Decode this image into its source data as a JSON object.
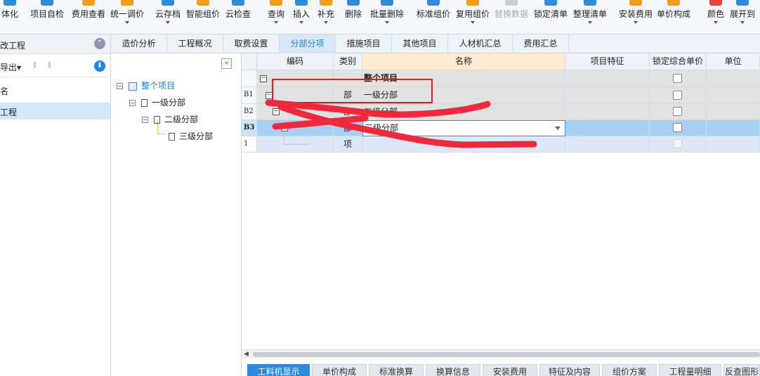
{
  "toolbar": {
    "items": [
      {
        "label": "体化",
        "icon": "integrate-icon",
        "arrow": false
      },
      {
        "label": "项目自检",
        "icon": "check-icon",
        "arrow": false
      },
      {
        "label": "费用查看",
        "icon": "fee-view-icon",
        "arrow": false
      },
      {
        "label": "统一调价",
        "icon": "price-adjust-icon",
        "arrow": true
      },
      {
        "label": "云存档",
        "icon": "cloud-save-icon",
        "arrow": true
      },
      {
        "label": "智能组价",
        "icon": "smart-price-icon",
        "arrow": false
      },
      {
        "label": "云检查",
        "icon": "cloud-check-icon",
        "arrow": false
      },
      {
        "label": "查询",
        "icon": "search-icon",
        "arrow": true
      },
      {
        "label": "插入",
        "icon": "insert-icon",
        "arrow": true
      },
      {
        "label": "补充",
        "icon": "supplement-icon",
        "arrow": true
      },
      {
        "label": "删除",
        "icon": "delete-icon",
        "arrow": false
      },
      {
        "label": "批量删除",
        "icon": "batch-delete-icon",
        "arrow": true
      },
      {
        "label": "标准组价",
        "icon": "standard-price-icon",
        "arrow": false
      },
      {
        "label": "复用组价",
        "icon": "reuse-price-icon",
        "arrow": true
      },
      {
        "label": "替换数据",
        "icon": "replace-data-icon",
        "arrow": false,
        "disabled": true
      },
      {
        "label": "锁定清单",
        "icon": "lock-icon",
        "arrow": false
      },
      {
        "label": "整理清单",
        "icon": "organize-icon",
        "arrow": true
      },
      {
        "label": "安装费用",
        "icon": "install-fee-icon",
        "arrow": true
      },
      {
        "label": "单价构成",
        "icon": "unit-price-icon",
        "arrow": false
      },
      {
        "label": "颜色",
        "icon": "color-icon",
        "arrow": true
      },
      {
        "label": "展开到",
        "icon": "expand-icon",
        "arrow": true
      }
    ]
  },
  "left_panel": {
    "title": "改工程",
    "export_label": "导出",
    "items": [
      "名",
      "工程"
    ]
  },
  "tabs": [
    "造价分析",
    "工程概况",
    "取费设置",
    "分部分项",
    "措施项目",
    "其他项目",
    "人材机汇总",
    "费用汇总"
  ],
  "active_tab": "分部分项",
  "tree": {
    "root": "整个项目",
    "level1": "一级分部",
    "level2": "二级分部",
    "level3": "三级分部"
  },
  "grid": {
    "columns": [
      "编码",
      "类别",
      "名称",
      "项目特征",
      "锁定综合单价",
      "单位"
    ],
    "rows": [
      {
        "num": "",
        "code": "",
        "category": "",
        "name": "整个项目"
      },
      {
        "num": "B1",
        "code": "",
        "category": "部",
        "name": "一级分部"
      },
      {
        "num": "B2",
        "code": "",
        "category": "部",
        "name": "二级分部"
      },
      {
        "num": "B3",
        "code": "",
        "category": "部",
        "name": "三级分部"
      },
      {
        "num": "1",
        "code": "",
        "category": "项",
        "name": ""
      }
    ]
  },
  "bottom_tabs": [
    "工料机显示",
    "单价构成",
    "标准换算",
    "换算信息",
    "安装费用",
    "特征及内容",
    "组价方案",
    "工程量明细",
    "反查图形"
  ],
  "active_bottom_tab": "工料机显示",
  "colors": {
    "accent": "#1e7fd8",
    "annotation_red": "#e8191c",
    "scribble_red": "#f0283c"
  }
}
